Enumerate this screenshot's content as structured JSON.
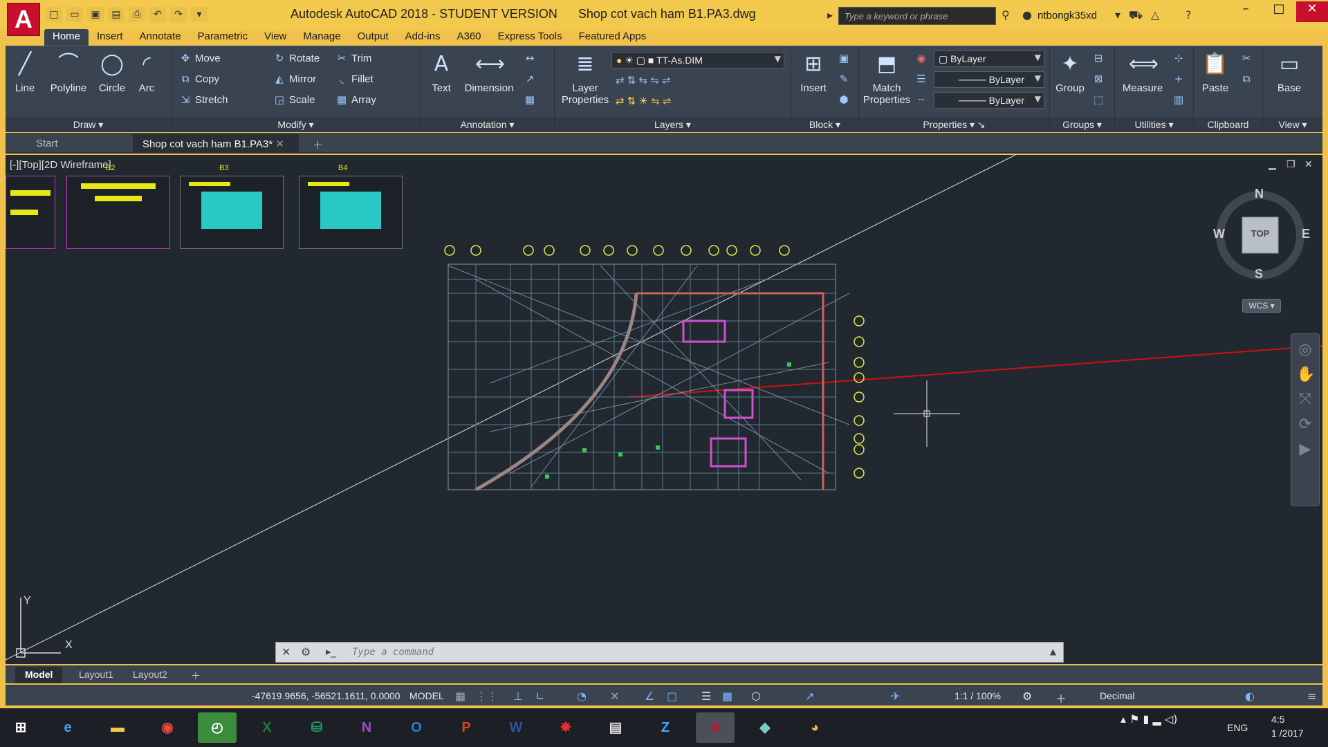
{
  "title_bar": {
    "logo": "A",
    "title": "Autodesk AutoCAD 2018 - STUDENT VERSION      Shop cot vach ham B1.PA3.dwg",
    "search_placeholder": "Type a keyword or phrase",
    "user": "ntbongk35xd"
  },
  "ribbon_tabs": [
    "Home",
    "Insert",
    "Annotate",
    "Parametric",
    "View",
    "Manage",
    "Output",
    "Add-ins",
    "A360",
    "Express Tools",
    "Featured Apps"
  ],
  "panels": {
    "draw": {
      "title": "Draw",
      "line": "Line",
      "polyline": "Polyline",
      "circle": "Circle",
      "arc": "Arc"
    },
    "modify": {
      "title": "Modify",
      "move": "Move",
      "rotate": "Rotate",
      "trim": "Trim",
      "copy": "Copy",
      "mirror": "Mirror",
      "fillet": "Fillet",
      "stretch": "Stretch",
      "scale": "Scale",
      "array": "Array"
    },
    "annotation": {
      "title": "Annotation",
      "text": "Text",
      "dimension": "Dimension"
    },
    "layers": {
      "title": "Layers",
      "layer_properties": "Layer\nProperties",
      "current_layer": "TT-As.DIM"
    },
    "block": {
      "title": "Block",
      "insert": "Insert"
    },
    "properties": {
      "title": "Properties",
      "match": "Match\nProperties",
      "color": "ByLayer",
      "linetype": "ByLayer",
      "lineweight": "ByLayer"
    },
    "groups": {
      "title": "Groups",
      "group": "Group"
    },
    "utilities": {
      "title": "Utilities",
      "measure": "Measure"
    },
    "clipboard": {
      "title": "Clipboard",
      "paste": "Paste"
    },
    "view": {
      "title": "View",
      "base": "Base"
    }
  },
  "doc_tabs": {
    "start": "Start",
    "active": "Shop cot vach ham B1.PA3*"
  },
  "viewport": {
    "label": "[-][Top][2D Wireframe]",
    "compass": {
      "n": "N",
      "s": "S",
      "e": "E",
      "w": "W",
      "top": "TOP"
    },
    "wcs": "WCS",
    "ucs_x": "X",
    "ucs_y": "Y",
    "thumb_tags": [
      "B2",
      "B3",
      "B4"
    ]
  },
  "command": {
    "placeholder": "Type a command"
  },
  "layout_tabs": [
    "Model",
    "Layout1",
    "Layout2"
  ],
  "status": {
    "coords": "-47619.9656, -56521.1611, 0.0000",
    "mode": "MODEL",
    "scale": "1:1 / 100%",
    "units": "Decimal"
  },
  "taskbar": {
    "lang": "ENG",
    "time": "4:5",
    "date": "1 /2017"
  },
  "colors": {
    "accent": "#c8102e",
    "ribbon": "#3a4350",
    "canvas": "#212830",
    "highlight": "#f0c24b"
  }
}
